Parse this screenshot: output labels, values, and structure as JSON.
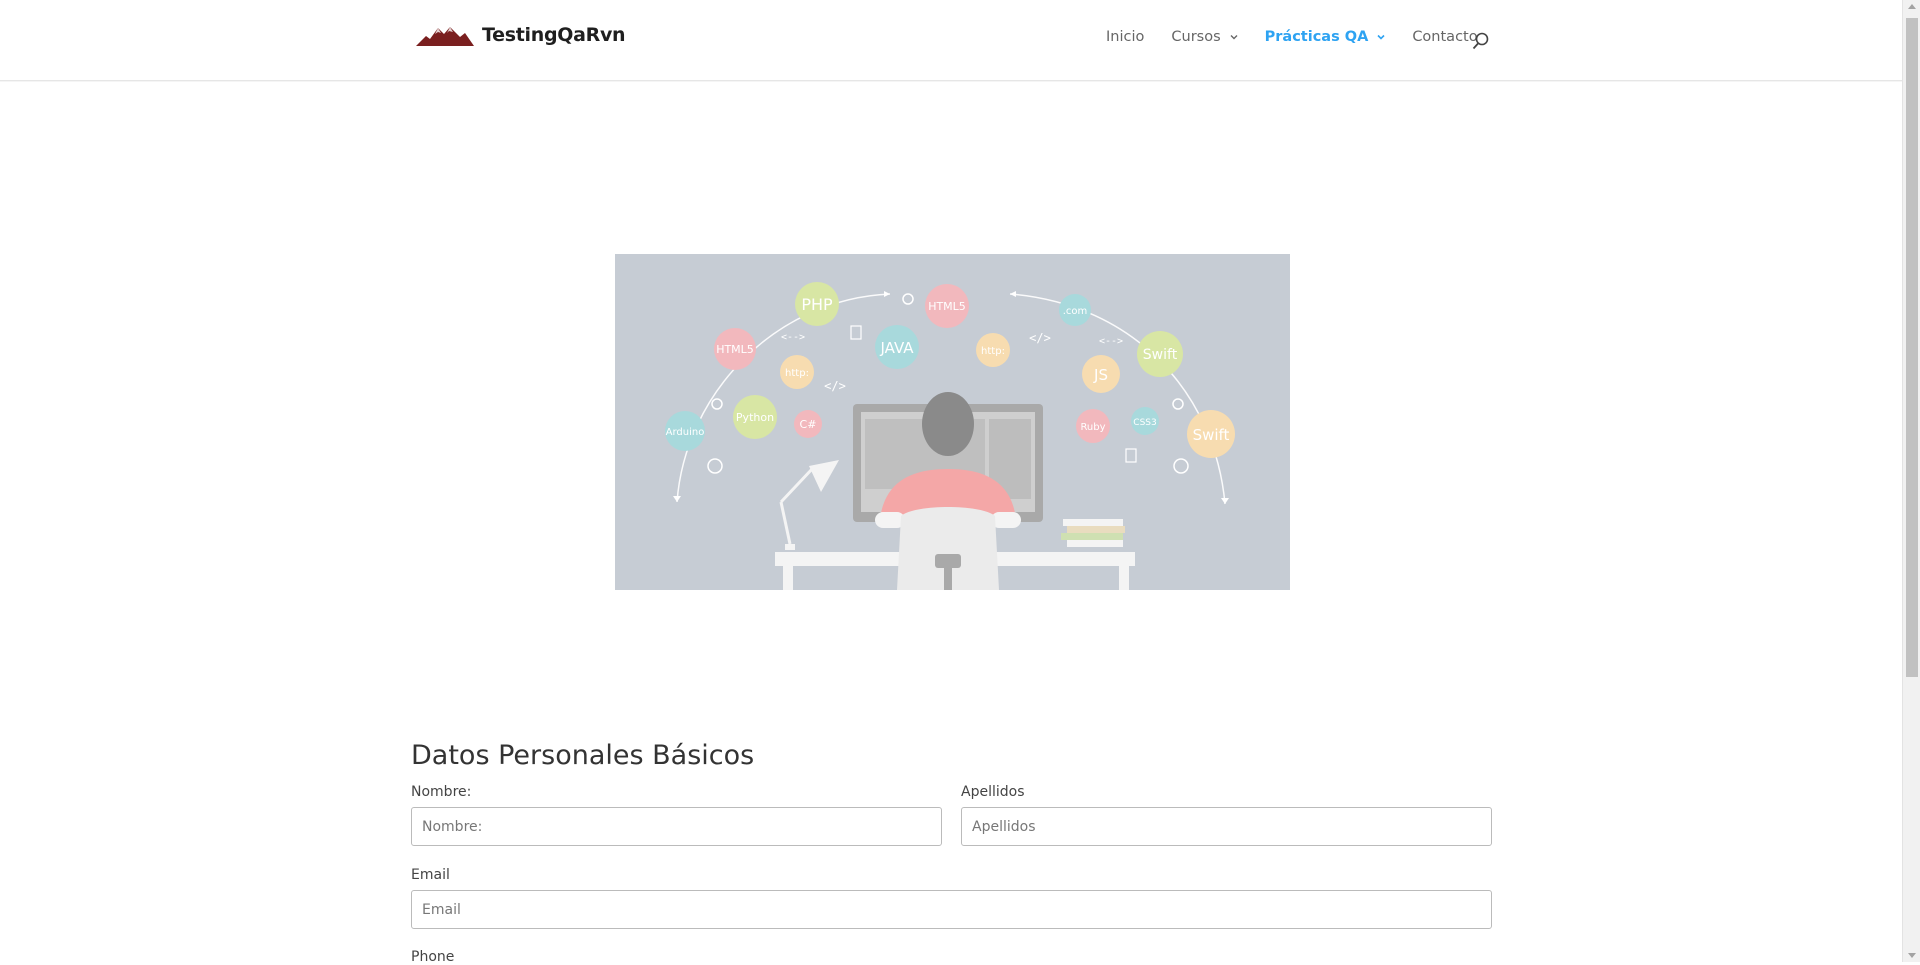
{
  "header": {
    "logo_text": "TestingQaRvn",
    "nav": [
      {
        "label": "Inicio",
        "has_dropdown": false,
        "active": false
      },
      {
        "label": "Cursos",
        "has_dropdown": true,
        "active": false
      },
      {
        "label": "Prácticas QA",
        "has_dropdown": true,
        "active": true
      },
      {
        "label": "Contacto",
        "has_dropdown": false,
        "active": false
      }
    ],
    "search_icon": "search-icon"
  },
  "hero": {
    "bubbles": [
      "PHP",
      "HTML5",
      ".com",
      "HTML5",
      "JAVA",
      "http:",
      "Swift",
      "http:",
      "JS",
      "Arduino",
      "Python",
      "C#",
      "Ruby",
      "CSS3",
      "Swift"
    ],
    "code_marks": [
      "<-->",
      "</>",
      "</>",
      "<-->"
    ]
  },
  "form": {
    "title": "Datos Personales Básicos",
    "nombre_label": "Nombre:",
    "nombre_placeholder": "Nombre:",
    "apellidos_label": "Apellidos",
    "apellidos_placeholder": "Apellidos",
    "email_label": "Email",
    "email_placeholder": "Email",
    "phone_label": "Phone"
  },
  "colors": {
    "accent": "#2ea3f2",
    "text": "#666666",
    "hero_bg": "#c6ccd4"
  }
}
